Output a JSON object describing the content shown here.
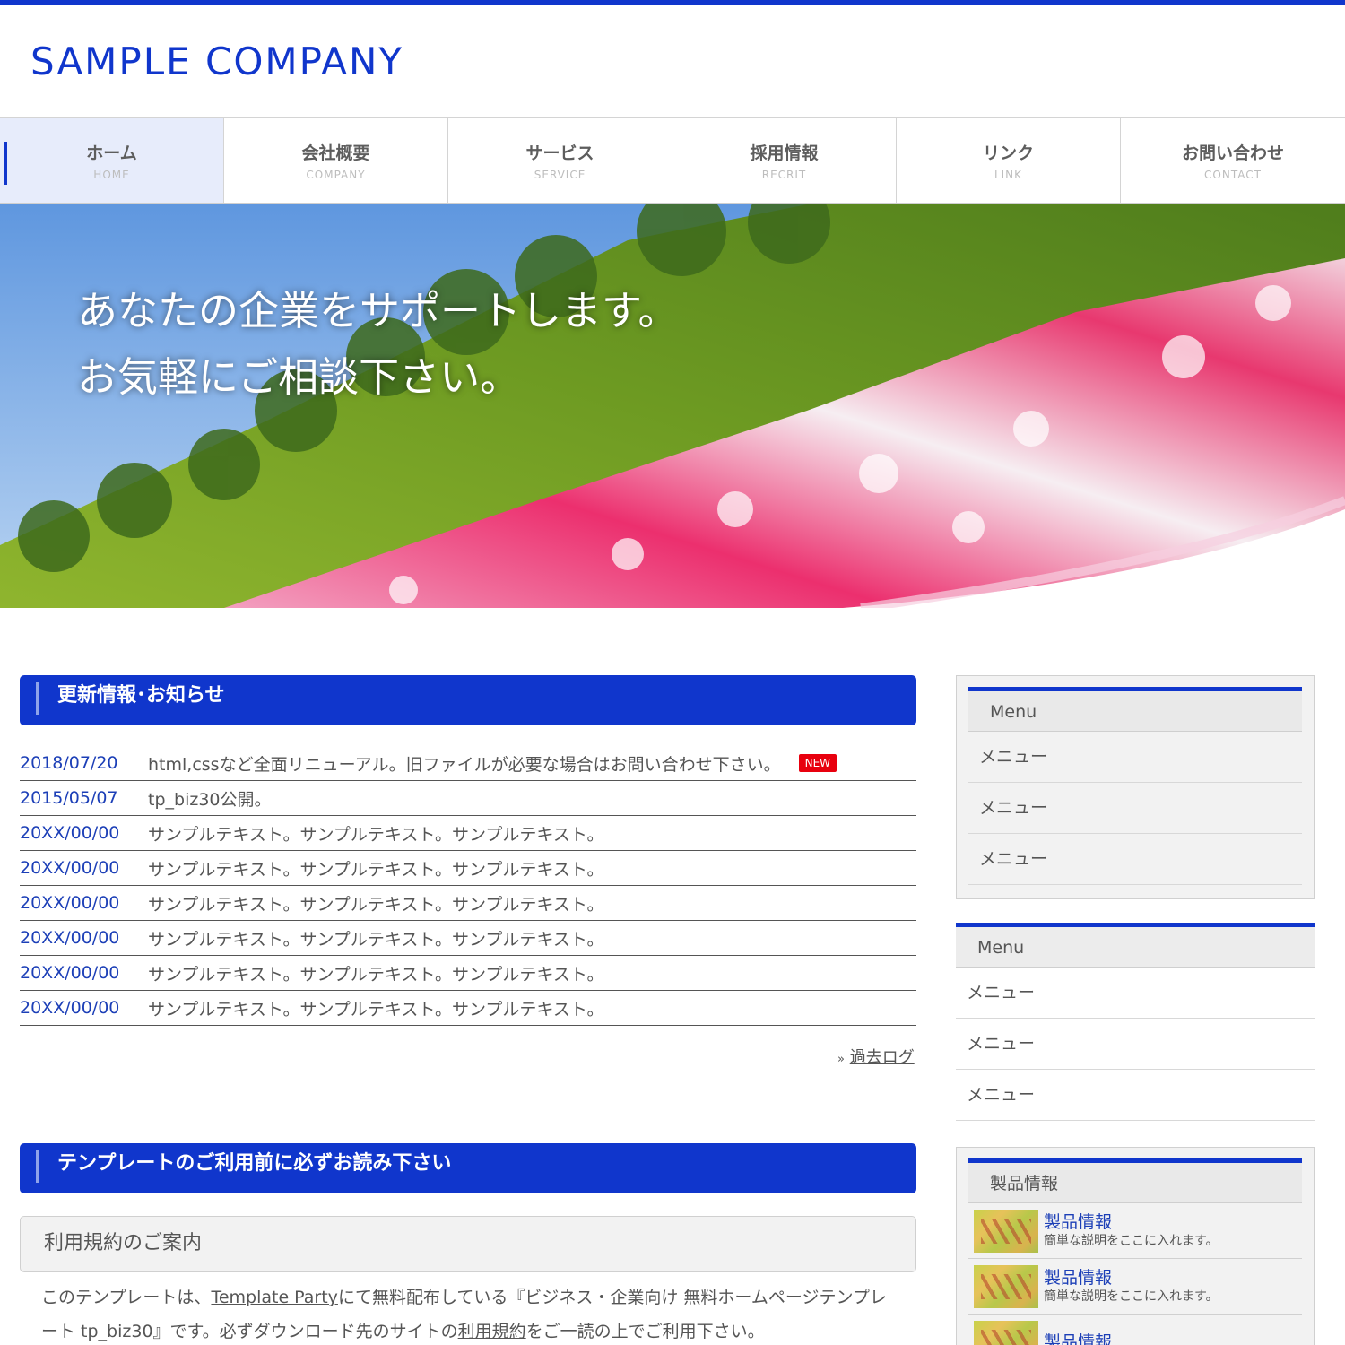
{
  "header": {
    "logo": "SAMPLE COMPANY"
  },
  "nav": [
    {
      "jp": "ホーム",
      "en": "HOME"
    },
    {
      "jp": "会社概要",
      "en": "COMPANY"
    },
    {
      "jp": "サービス",
      "en": "SERVICE"
    },
    {
      "jp": "採用情報",
      "en": "RECRIT"
    },
    {
      "jp": "リンク",
      "en": "LINK"
    },
    {
      "jp": "お問い合わせ",
      "en": "CONTACT"
    }
  ],
  "hero": {
    "line1": "あなたの企業をサポートします。",
    "line2": "お気軽にご相談下さい。"
  },
  "news": {
    "heading": "更新情報･お知らせ",
    "items": [
      {
        "date": "2018/07/20",
        "text": "html,cssなど全面リニューアル。旧ファイルが必要な場合はお問い合わせ下さい。",
        "badge": "NEW"
      },
      {
        "date": "2015/05/07",
        "text": "tp_biz30公開。"
      },
      {
        "date": "20XX/00/00",
        "text": "サンプルテキスト。サンプルテキスト。サンプルテキスト。"
      },
      {
        "date": "20XX/00/00",
        "text": "サンプルテキスト。サンプルテキスト。サンプルテキスト。"
      },
      {
        "date": "20XX/00/00",
        "text": "サンプルテキスト。サンプルテキスト。サンプルテキスト。"
      },
      {
        "date": "20XX/00/00",
        "text": "サンプルテキスト。サンプルテキスト。サンプルテキスト。"
      },
      {
        "date": "20XX/00/00",
        "text": "サンプルテキスト。サンプルテキスト。サンプルテキスト。"
      },
      {
        "date": "20XX/00/00",
        "text": "サンプルテキスト。サンプルテキスト。サンプルテキスト。"
      }
    ],
    "more_arrow": "»",
    "more_link": "過去ログ"
  },
  "template_notice": {
    "heading": "テンプレートのご利用前に必ずお読み下さい",
    "box_title": "利用規約のご案内",
    "text_1": "このテンプレートは、",
    "link_1": "Template Party",
    "text_2": "にて無料配布している『ビジネス・企業向け 無料ホームページテンプレート tp_biz30』です。必ずダウンロード先のサイトの",
    "link_2": "利用規約",
    "text_3": "をご一読の上でご利用下さい。"
  },
  "sidebar": {
    "box1": {
      "title": "Menu",
      "items": [
        "メニュー",
        "メニュー",
        "メニュー"
      ]
    },
    "box2": {
      "title": "Menu",
      "items": [
        "メニュー",
        "メニュー",
        "メニュー"
      ]
    },
    "products": {
      "title": "製品情報",
      "items": [
        {
          "name": "製品情報",
          "desc": "簡単な説明をここに入れます。"
        },
        {
          "name": "製品情報",
          "desc": "簡単な説明をここに入れます。"
        },
        {
          "name": "製品情報",
          "desc": ""
        }
      ]
    }
  },
  "colors": {
    "accent": "#1036cc",
    "new_badge": "#e8000e",
    "date_text": "#1c3fb7"
  }
}
